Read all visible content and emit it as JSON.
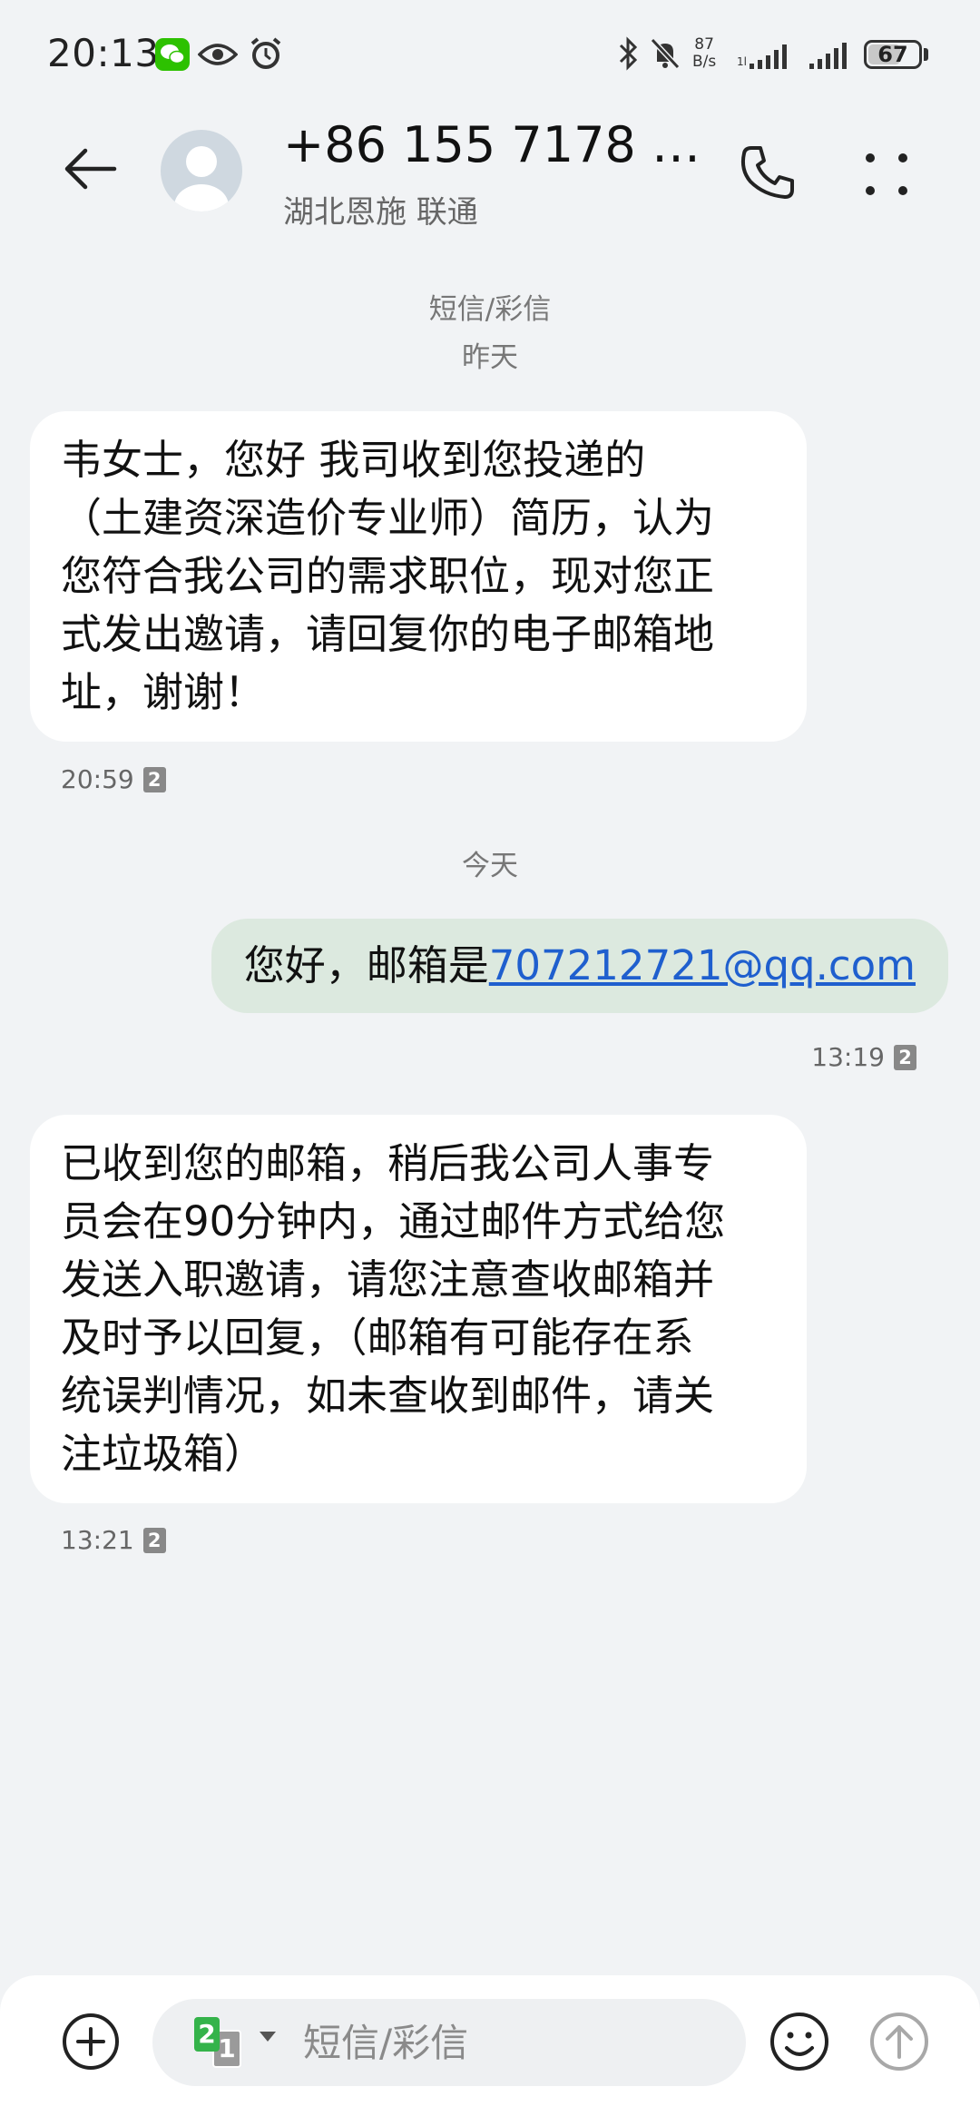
{
  "status_bar": {
    "time": "20:13",
    "net_speed_value": "87",
    "net_speed_unit": "B/s",
    "battery": "67",
    "battery_level_percent": 67,
    "icons": [
      "wechat-icon",
      "eye-icon",
      "alarm-icon",
      "bluetooth-icon",
      "mute-icon",
      "signal-hd-icon",
      "signal-icon"
    ]
  },
  "header": {
    "contact_name": "+86 155 7178 1...",
    "contact_sub": "湖北恩施 联通",
    "icons": [
      "back-arrow-icon",
      "avatar-icon",
      "phone-icon",
      "more-icon"
    ]
  },
  "conversation": {
    "type_label": "短信/彩信",
    "day_yesterday": "昨天",
    "msg1": {
      "lines": [
        "韦女士，您好 我司收到您投递的",
        "（土建资深造价专业师）简历，认为",
        "您符合我公司的需求职位，现对您正",
        "式发出邀请，请回复你的电子邮箱地",
        "址，谢谢！"
      ],
      "time": "20:59",
      "sim": "2"
    },
    "day_today": "今天",
    "msg2": {
      "prefix": "您好，邮箱是",
      "email": "707212721@qq.com",
      "time": "13:19",
      "sim": "2"
    },
    "msg3": {
      "lines": [
        "已收到您的邮箱，稍后我公司人事专",
        "员会在90分钟内，通过邮件方式给您",
        "发送入职邀请，请您注意查收邮箱并",
        "及时予以回复，（邮箱有可能存在系",
        "统误判情况，如未查收到邮件，请关",
        "注垃圾箱）"
      ],
      "time": "13:21",
      "sim": "2"
    }
  },
  "composer": {
    "placeholder": "短信/彩信",
    "sim_front": "2",
    "sim_back": "1",
    "icons": [
      "add-icon",
      "sim-switch-icon",
      "emoji-icon",
      "send-icon"
    ]
  },
  "colors": {
    "background": "#f1f3f5",
    "incoming_bubble": "#ffffff",
    "outgoing_bubble": "#dce9df",
    "link": "#1f5fce",
    "sim_active": "#34b34a"
  }
}
